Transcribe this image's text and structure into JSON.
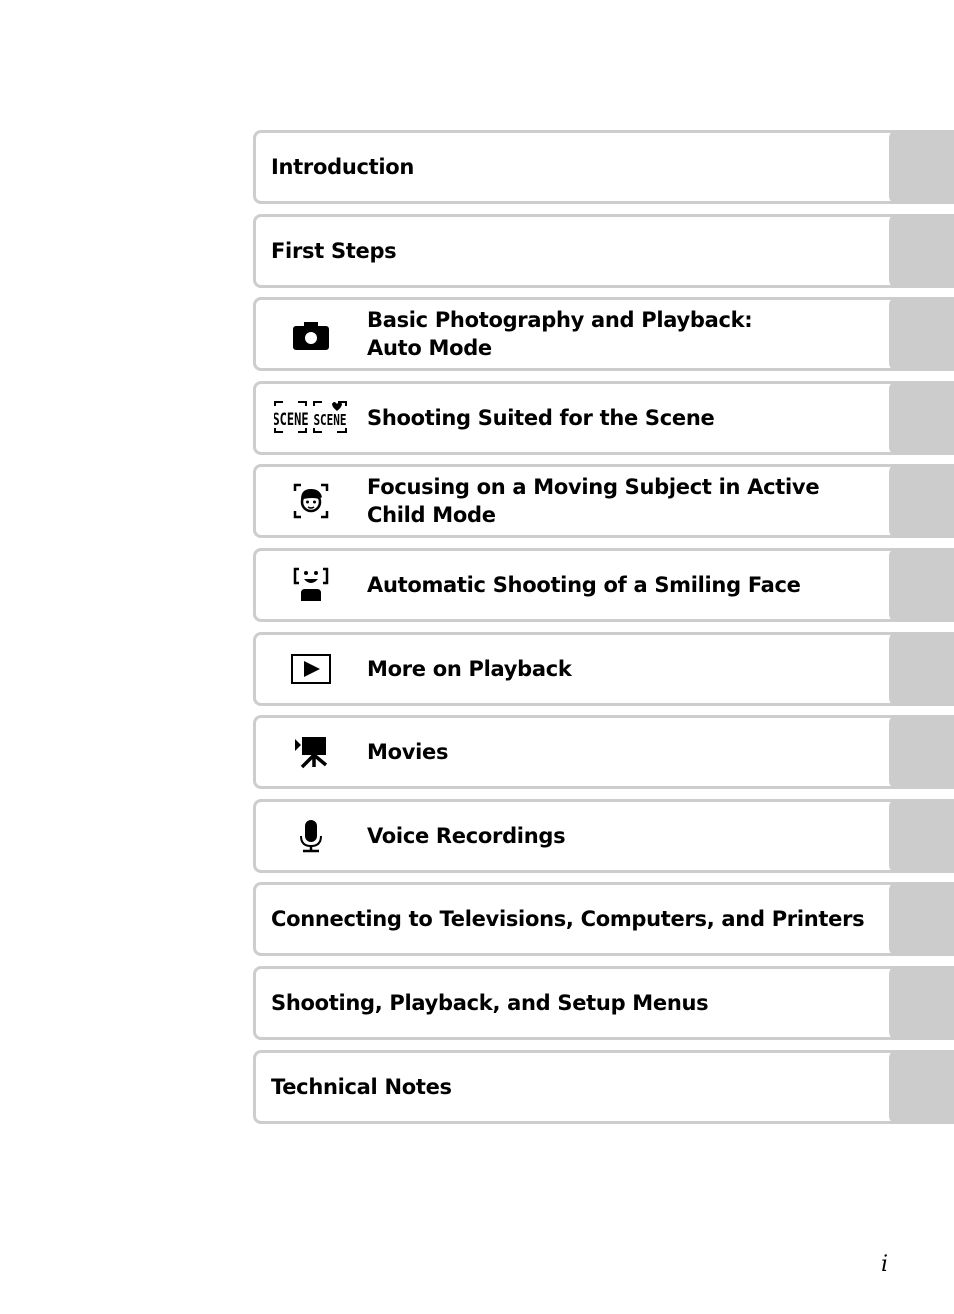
{
  "toc": {
    "entries": [
      {
        "label": "Introduction",
        "icon": null
      },
      {
        "label": "First Steps",
        "icon": null
      },
      {
        "label": "Basic Photography and Playback:\nAuto Mode",
        "icon": "camera-icon"
      },
      {
        "label": "Shooting Suited for the Scene",
        "icon": "scene-icons"
      },
      {
        "label": "Focusing on a Moving Subject in Active Child Mode",
        "icon": "active-child-icon"
      },
      {
        "label": "Automatic Shooting of a Smiling Face",
        "icon": "smile-face-icon"
      },
      {
        "label": "More on Playback",
        "icon": "playback-icon"
      },
      {
        "label": "Movies",
        "icon": "movie-camera-icon"
      },
      {
        "label": "Voice Recordings",
        "icon": "microphone-icon"
      },
      {
        "label": "Connecting to Televisions, Computers, and Printers",
        "icon": null
      },
      {
        "label": "Shooting, Playback, and Setup Menus",
        "icon": null
      },
      {
        "label": "Technical Notes",
        "icon": null
      }
    ]
  },
  "page_number": "i"
}
